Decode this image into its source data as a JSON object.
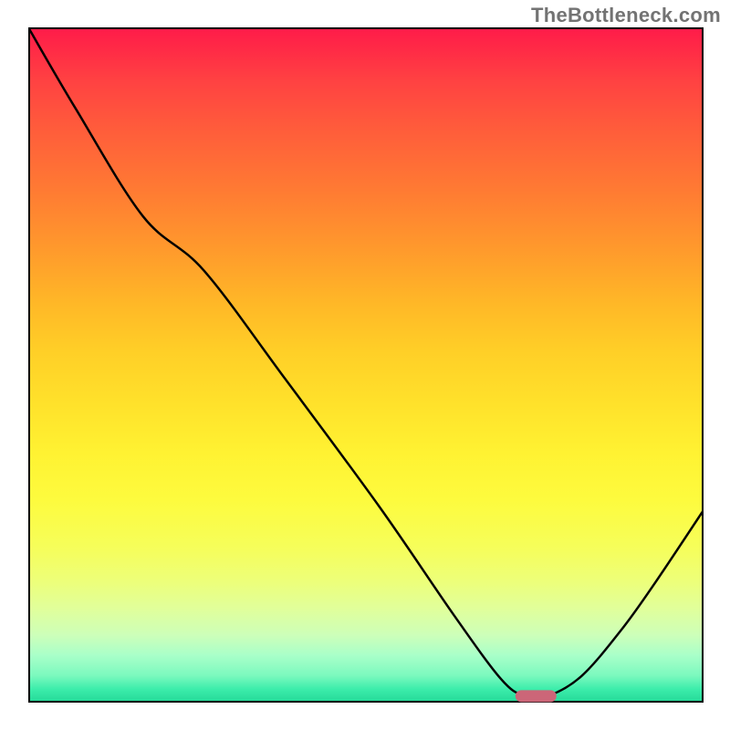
{
  "watermark": "TheBottleneck.com",
  "chart_data": {
    "type": "line",
    "title": "",
    "xlabel": "",
    "ylabel": "",
    "xlim": [
      0,
      1
    ],
    "ylim": [
      0,
      1
    ],
    "axes_visible": false,
    "gradient": {
      "direction": "vertical",
      "stops": [
        {
          "pos": 0.0,
          "color": "#ff1b4a"
        },
        {
          "pos": 0.25,
          "color": "#ff7a33"
        },
        {
          "pos": 0.5,
          "color": "#ffd827"
        },
        {
          "pos": 0.75,
          "color": "#f2ff5e"
        },
        {
          "pos": 0.95,
          "color": "#9fffc2"
        },
        {
          "pos": 1.0,
          "color": "#23d897"
        }
      ]
    },
    "series": [
      {
        "name": "bottleneck-curve",
        "color": "#000000",
        "x": [
          0.0,
          0.07,
          0.17,
          0.26,
          0.38,
          0.52,
          0.63,
          0.7,
          0.735,
          0.77,
          0.82,
          0.88,
          0.93,
          1.0
        ],
        "y": [
          1.0,
          0.88,
          0.72,
          0.64,
          0.48,
          0.29,
          0.13,
          0.035,
          0.01,
          0.01,
          0.04,
          0.11,
          0.18,
          0.285
        ]
      }
    ],
    "marker": {
      "x": 0.752,
      "y": 0.01,
      "width_frac": 0.06,
      "height_frac": 0.018,
      "color": "#cc6678",
      "shape": "pill"
    }
  }
}
